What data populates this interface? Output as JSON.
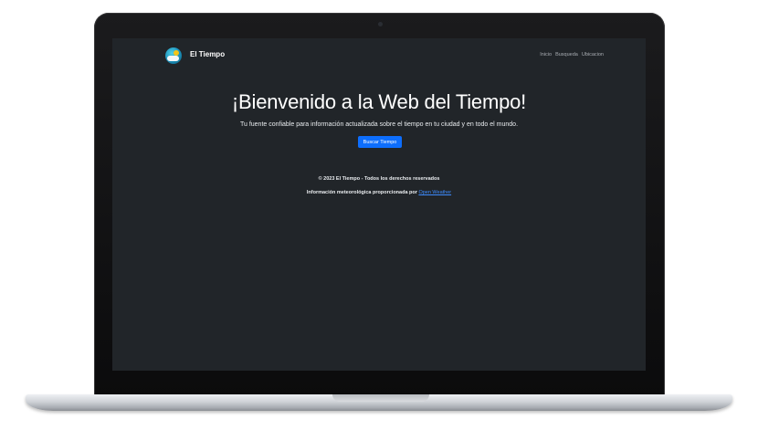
{
  "navbar": {
    "brand": "El Tiempo",
    "links": [
      "Inicio",
      "Busqueda",
      "Ubicacion"
    ]
  },
  "hero": {
    "title": "¡Bienvenido a la Web del Tiempo!",
    "subtitle": "Tu fuente confiable para información actualizada sobre el tiempo en tu ciudad y en todo el mundo.",
    "button": "Buscar Tiempo"
  },
  "footer": {
    "copyright": "© 2023 El Tiempo - Todos los derechos reservados",
    "info_prefix": "Información meteorológica proporcionada por",
    "info_link": "Open Weather"
  },
  "colors": {
    "background": "#212529",
    "primary": "#0d6efd",
    "link": "#3d8bfd"
  },
  "icons": {
    "brand": "weather-logo-icon"
  }
}
